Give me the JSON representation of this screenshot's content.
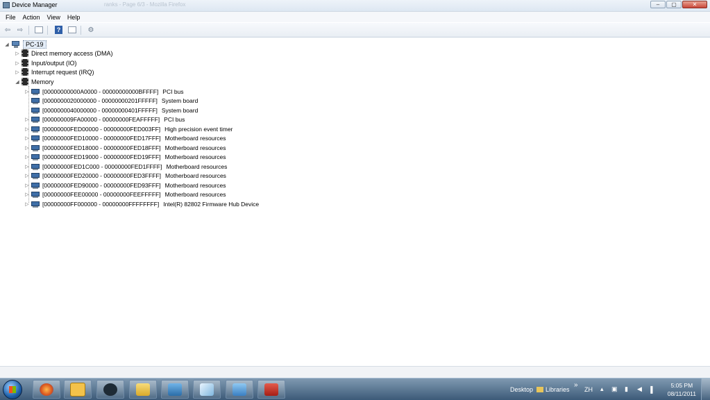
{
  "window": {
    "title": "Device Manager",
    "ghost_title": "ranks - Page 6/3 - Mozilla Firefox",
    "buttons": {
      "minimize": "–",
      "maximize": "▢",
      "close": "✕"
    }
  },
  "menu": [
    "File",
    "Action",
    "View",
    "Help"
  ],
  "toolbar": {
    "back_icon": "back-arrow-icon",
    "forward_icon": "forward-arrow-icon",
    "help_label": "?"
  },
  "tree": {
    "root": "PC-19",
    "categories": [
      "Direct memory access (DMA)",
      "Input/output (IO)",
      "Interrupt request (IRQ)",
      "Memory"
    ],
    "memory_items": [
      {
        "range": "[00000000000A0000 - 00000000000BFFFF]",
        "desc": "PCI bus",
        "expandable": true
      },
      {
        "range": "[0000000020000000 - 00000000201FFFFF]",
        "desc": "System board",
        "expandable": false
      },
      {
        "range": "[0000000040000000 - 00000000401FFFFF]",
        "desc": "System board",
        "expandable": false
      },
      {
        "range": "[000000009FA00000 - 00000000FEAFFFFF]",
        "desc": "PCI bus",
        "expandable": true
      },
      {
        "range": "[00000000FED00000 - 00000000FED003FF]",
        "desc": "High precision event timer",
        "expandable": true
      },
      {
        "range": "[00000000FED10000 - 00000000FED17FFF]",
        "desc": "Motherboard resources",
        "expandable": true
      },
      {
        "range": "[00000000FED18000 - 00000000FED18FFF]",
        "desc": "Motherboard resources",
        "expandable": true
      },
      {
        "range": "[00000000FED19000 - 00000000FED19FFF]",
        "desc": "Motherboard resources",
        "expandable": true
      },
      {
        "range": "[00000000FED1C000 - 00000000FED1FFFF]",
        "desc": "Motherboard resources",
        "expandable": true
      },
      {
        "range": "[00000000FED20000 - 00000000FED3FFFF]",
        "desc": "Motherboard resources",
        "expandable": true
      },
      {
        "range": "[00000000FED90000 - 00000000FED93FFF]",
        "desc": "Motherboard resources",
        "expandable": true
      },
      {
        "range": "[00000000FEE00000 - 00000000FEEFFFFF]",
        "desc": "Motherboard resources",
        "expandable": true
      },
      {
        "range": "[00000000FF000000 - 00000000FFFFFFFF]",
        "desc": "Intel(R) 82802 Firmware Hub Device",
        "expandable": true
      }
    ]
  },
  "taskbar": {
    "apps": [
      "firefox",
      "outlook",
      "steam",
      "explorer",
      "photo-viewer",
      "notepad",
      "remote-desktop",
      "toolbox"
    ],
    "desktop_label": "Desktop",
    "libraries_label": "Libraries",
    "chevron": "»",
    "lang": "ZH",
    "time": "5:05 PM",
    "date": "08/11/2011"
  }
}
